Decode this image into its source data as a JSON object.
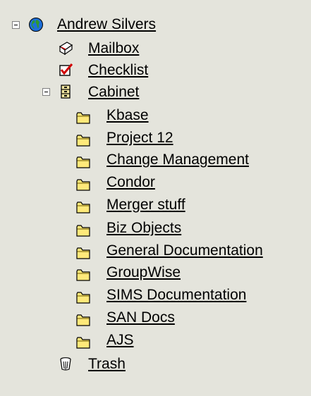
{
  "tree": {
    "root": {
      "label": "Andrew Silvers",
      "icon": "globe-icon",
      "expanded": true
    },
    "mailbox": {
      "label": "Mailbox",
      "icon": "mailbox-icon"
    },
    "checklist": {
      "label": "Checklist",
      "icon": "checklist-icon"
    },
    "cabinet": {
      "label": "Cabinet",
      "icon": "cabinet-icon",
      "expanded": true,
      "folders": [
        {
          "label": "Kbase"
        },
        {
          "label": "Project 12"
        },
        {
          "label": "Change Management"
        },
        {
          "label": "Condor"
        },
        {
          "label": "Merger stuff"
        },
        {
          "label": "Biz Objects"
        },
        {
          "label": "General Documentation"
        },
        {
          "label": "GroupWise"
        },
        {
          "label": "SIMS Documentation"
        },
        {
          "label": "SAN Docs"
        },
        {
          "label": "AJS"
        }
      ]
    },
    "trash": {
      "label": "Trash",
      "icon": "trash-icon"
    }
  },
  "colors": {
    "background": "#e4e4dc",
    "folder": "#ffe97a",
    "folder_outline": "#6b5a00",
    "check": "#d00000"
  }
}
